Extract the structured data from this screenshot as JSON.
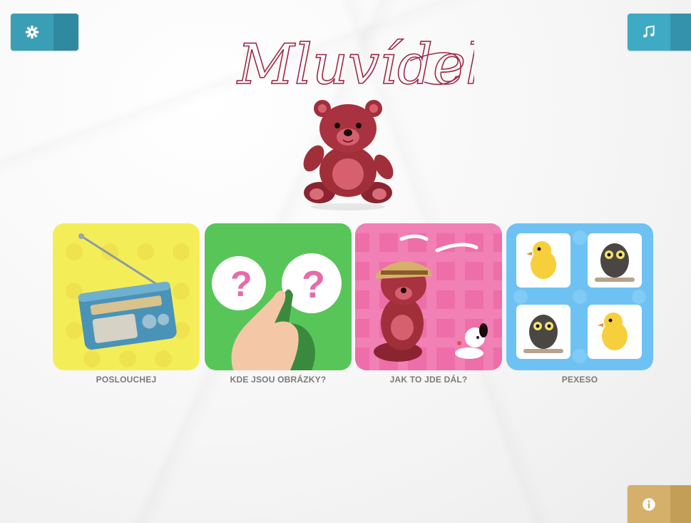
{
  "app": {
    "title": "Mluvídek"
  },
  "toolbar": {
    "settings_icon": "gear-icon",
    "music_icon": "music-note-icon",
    "info_icon": "info-icon"
  },
  "colors": {
    "settings_button": "#3a9fb6",
    "music_button": "#3eaac4",
    "info_button": "#d4b06a",
    "logo": "#9c2a49",
    "card_listen": "#f3ee57",
    "card_pictures": "#58c559",
    "card_continue": "#ee6ea9",
    "card_memory": "#6ec2f3"
  },
  "menu": {
    "items": [
      {
        "label": "POSLOUCHEJ",
        "icon": "radio-icon"
      },
      {
        "label": "KDE JSOU OBRÁZKY?",
        "icon": "hand-pointing-icon"
      },
      {
        "label": "JAK TO JDE DÁL?",
        "icon": "bear-with-dog-icon"
      },
      {
        "label": "PEXESO",
        "icon": "memory-cards-icon"
      }
    ]
  }
}
